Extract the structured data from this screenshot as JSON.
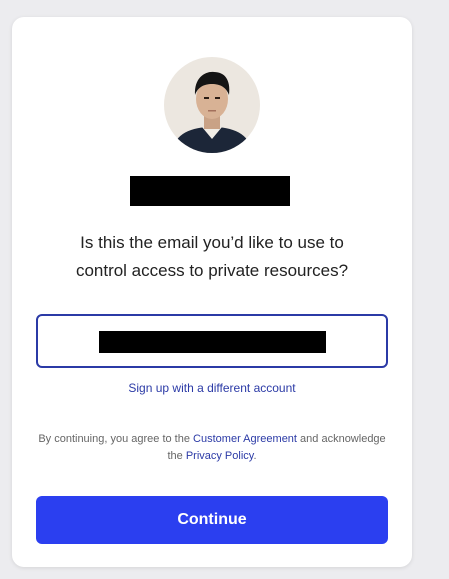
{
  "question": {
    "line1": "Is this the email you’d like to use to",
    "line2": "control access to private resources?"
  },
  "email_field": {
    "value": ""
  },
  "switch_account_label": "Sign up with a different account",
  "terms": {
    "prefix": "By continuing, you agree to the",
    "customer_agreement_label": "Customer Agreement",
    "middle": "and acknowledge the",
    "privacy_policy_label": "Privacy Policy",
    "suffix": "."
  },
  "continue_label": "Continue",
  "colors": {
    "accent": "#2b3ff0",
    "link": "#2b3aa6",
    "input_border": "#2b3aa6",
    "redaction": "#000000"
  }
}
